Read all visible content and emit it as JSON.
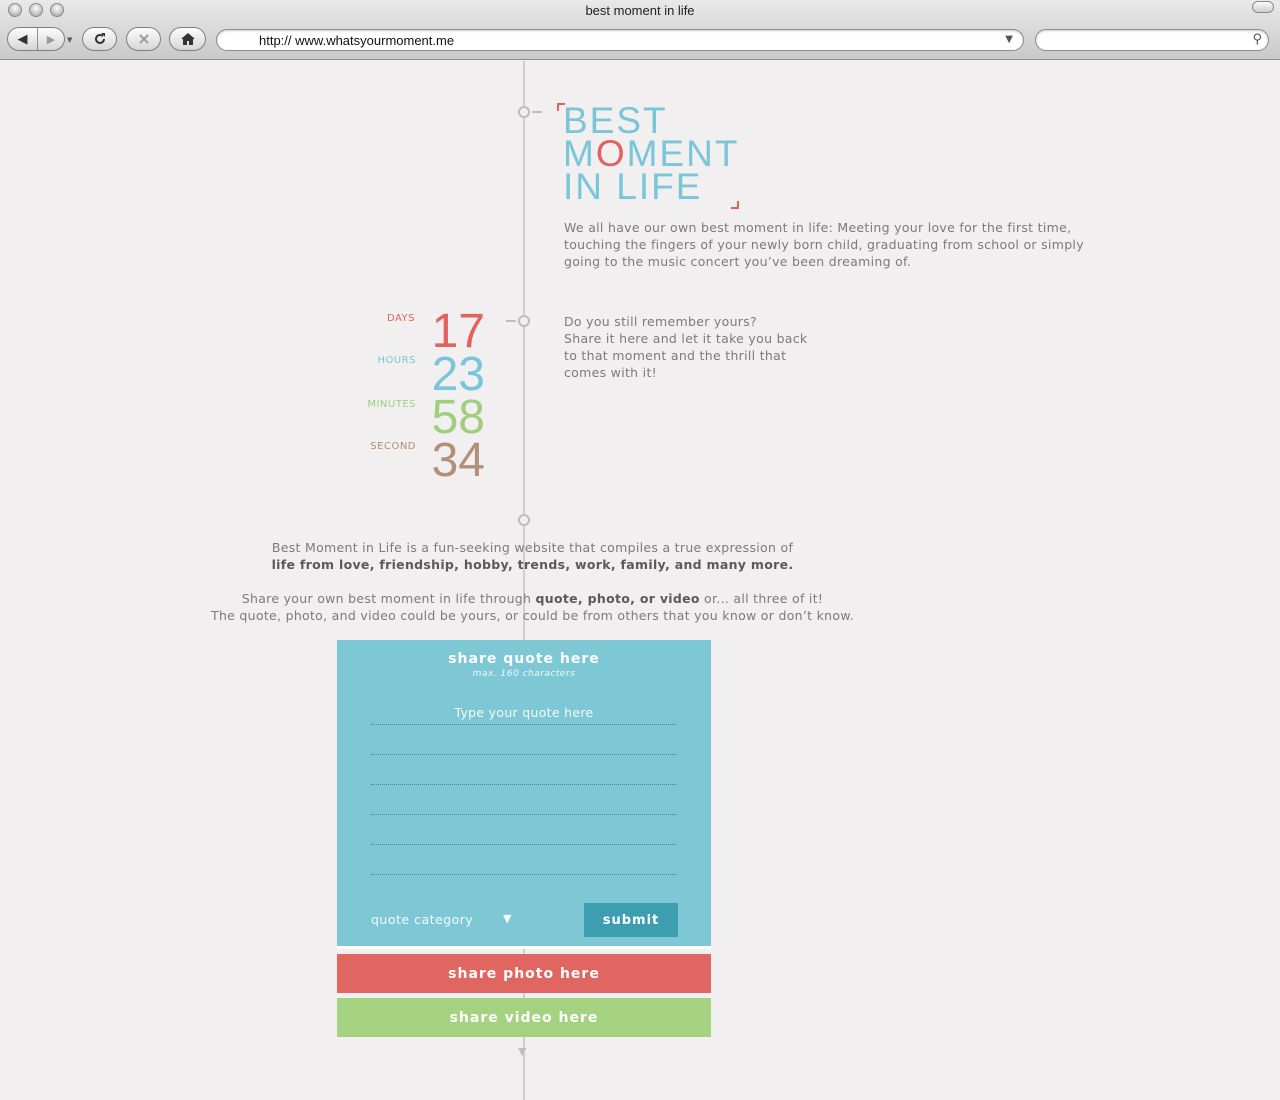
{
  "browser": {
    "window_title": "best moment in life",
    "url": "http:// www.whatsyourmoment.me"
  },
  "hero": {
    "title_line1": "BEST",
    "title_line2_pre": "M",
    "title_line2_o": "O",
    "title_line2_post": "MENT",
    "title_line3": "IN LIFE",
    "intro": "We all have our own best moment in life: Meeting your love for the first time, touching the fingers of your newly born child, graduating from school or simply going to the music concert you’ve been dreaming of."
  },
  "remember": "Do you still remember yours?\nShare it here and let it take you back\nto that moment and the thrill that\ncomes with it!",
  "countdown": {
    "days_label": "DAYS",
    "days": "17",
    "hours_label": "HOURS",
    "hours": "23",
    "minutes_label": "MINUTES",
    "minutes": "58",
    "seconds_label": "SECOND",
    "seconds": "34",
    "colors": {
      "days": "#e0635d",
      "hours": "#7ac6d8",
      "minutes": "#9fcf7e",
      "seconds": "#b48f78"
    }
  },
  "about": {
    "p1_text": "Best Moment in Life is a fun-seeking website that compiles a true expression of",
    "p1_bold": "life from love, friendship, hobby, trends, work, family, and many more.",
    "p2_pre": "Share your own best moment in life through ",
    "p2_bold": "quote, photo, or video",
    "p2_post": " or... all three of it!",
    "p3": "The quote, photo, and video could be yours, or could be from others that you know or don’t know."
  },
  "quote_panel": {
    "title": "share quote here",
    "limit": "max. 160 characters",
    "placeholder": "Type your quote here",
    "category_label": "quote category",
    "submit_label": "submit"
  },
  "photo_panel": {
    "title": "share photo here"
  },
  "video_panel": {
    "title": "share video here"
  },
  "colors": {
    "blue": "#7ec7d5",
    "red": "#e06661",
    "green": "#a4d280",
    "accent_red": "#e0635d",
    "title_blue": "#7ac6d8"
  }
}
